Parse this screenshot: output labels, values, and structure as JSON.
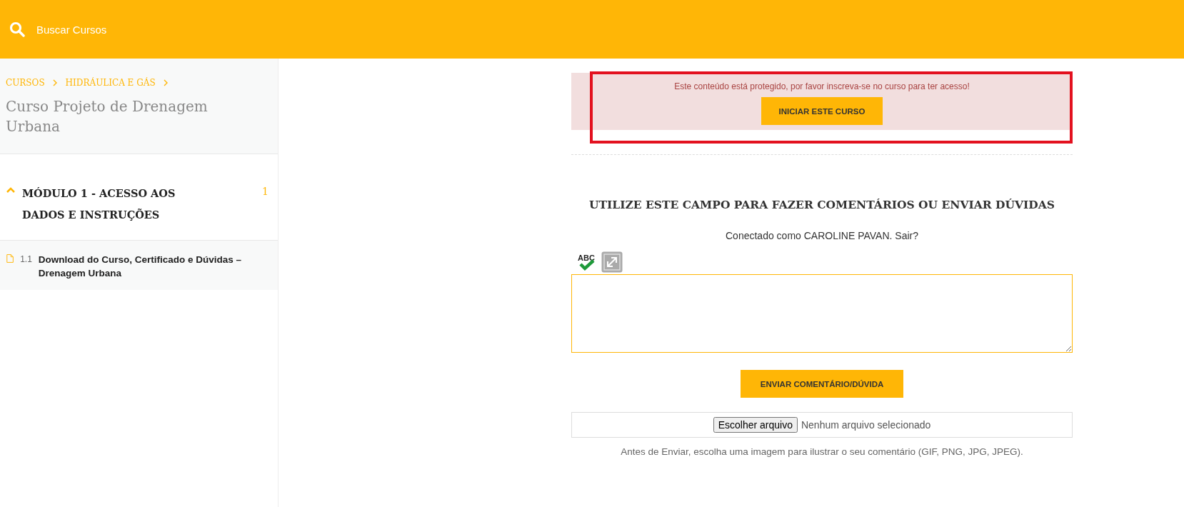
{
  "header": {
    "search": {
      "placeholder": "Buscar Cursos"
    }
  },
  "sidebar": {
    "breadcrumbs": [
      "CURSOS",
      "HIDRÁULICA E GÁS"
    ],
    "course_title": "Curso Projeto de Drenagem Urbana",
    "modules": [
      {
        "title": "MÓDULO 1 - ACESSO AOS DADOS E INSTRUÇÕES",
        "count": "1",
        "expanded": true,
        "lessons": [
          {
            "number": "1.1",
            "title": "Download do Curso, Certificado e Dúvidas – Drenagem Urbana"
          }
        ]
      }
    ]
  },
  "notice": {
    "message": "Este conteúdo está protegido, por favor inscreva-se no curso para ter acesso!",
    "button": "INICIAR ESTE CURSO",
    "highlighted": true
  },
  "comments": {
    "heading": "UTILIZE ESTE CAMPO PARA FAZER COMENTÁRIOS OU ENVIAR DÚVIDAS",
    "logged_in": "Conectado como CAROLINE PAVAN. Sair?",
    "spellcheck_label": "ABC",
    "submit": "ENVIAR COMENTÁRIO/DÚVIDA",
    "file_button": "Escolher arquivo",
    "file_status": "Nenhum arquivo selecionado",
    "hint": "Antes de Enviar, escolha uma imagem para ilustrar o seu comentário (GIF, PNG, JPG, JPEG)."
  }
}
